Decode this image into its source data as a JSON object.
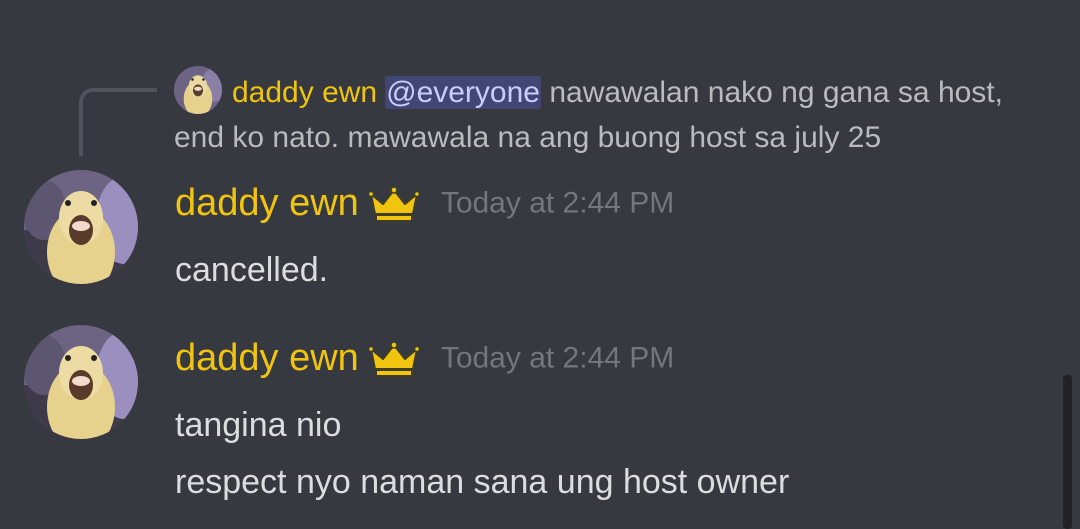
{
  "reply": {
    "author": "daddy ewn",
    "mention": "@everyone",
    "text": " nawawalan nako ng gana sa host, end ko nato. mawawala na ang buong host sa july 25"
  },
  "messages": [
    {
      "author": "daddy ewn",
      "timestamp": "Today at 2:44 PM",
      "lines": [
        "cancelled."
      ]
    },
    {
      "author": "daddy ewn",
      "timestamp": "Today at 2:44 PM",
      "lines": [
        "tangina nio",
        "respect nyo naman sana ung host owner"
      ]
    }
  ],
  "icons": {
    "owner_badge": "crown-icon",
    "avatar": "duck-avatar"
  },
  "colors": {
    "background": "#36393f",
    "author_role": "#f1c40f",
    "timestamp": "#72767d",
    "message_text": "#dcddde",
    "reply_text": "#b9bbbe",
    "mention_bg": "#414675",
    "mention_text": "#c9cdfb"
  }
}
